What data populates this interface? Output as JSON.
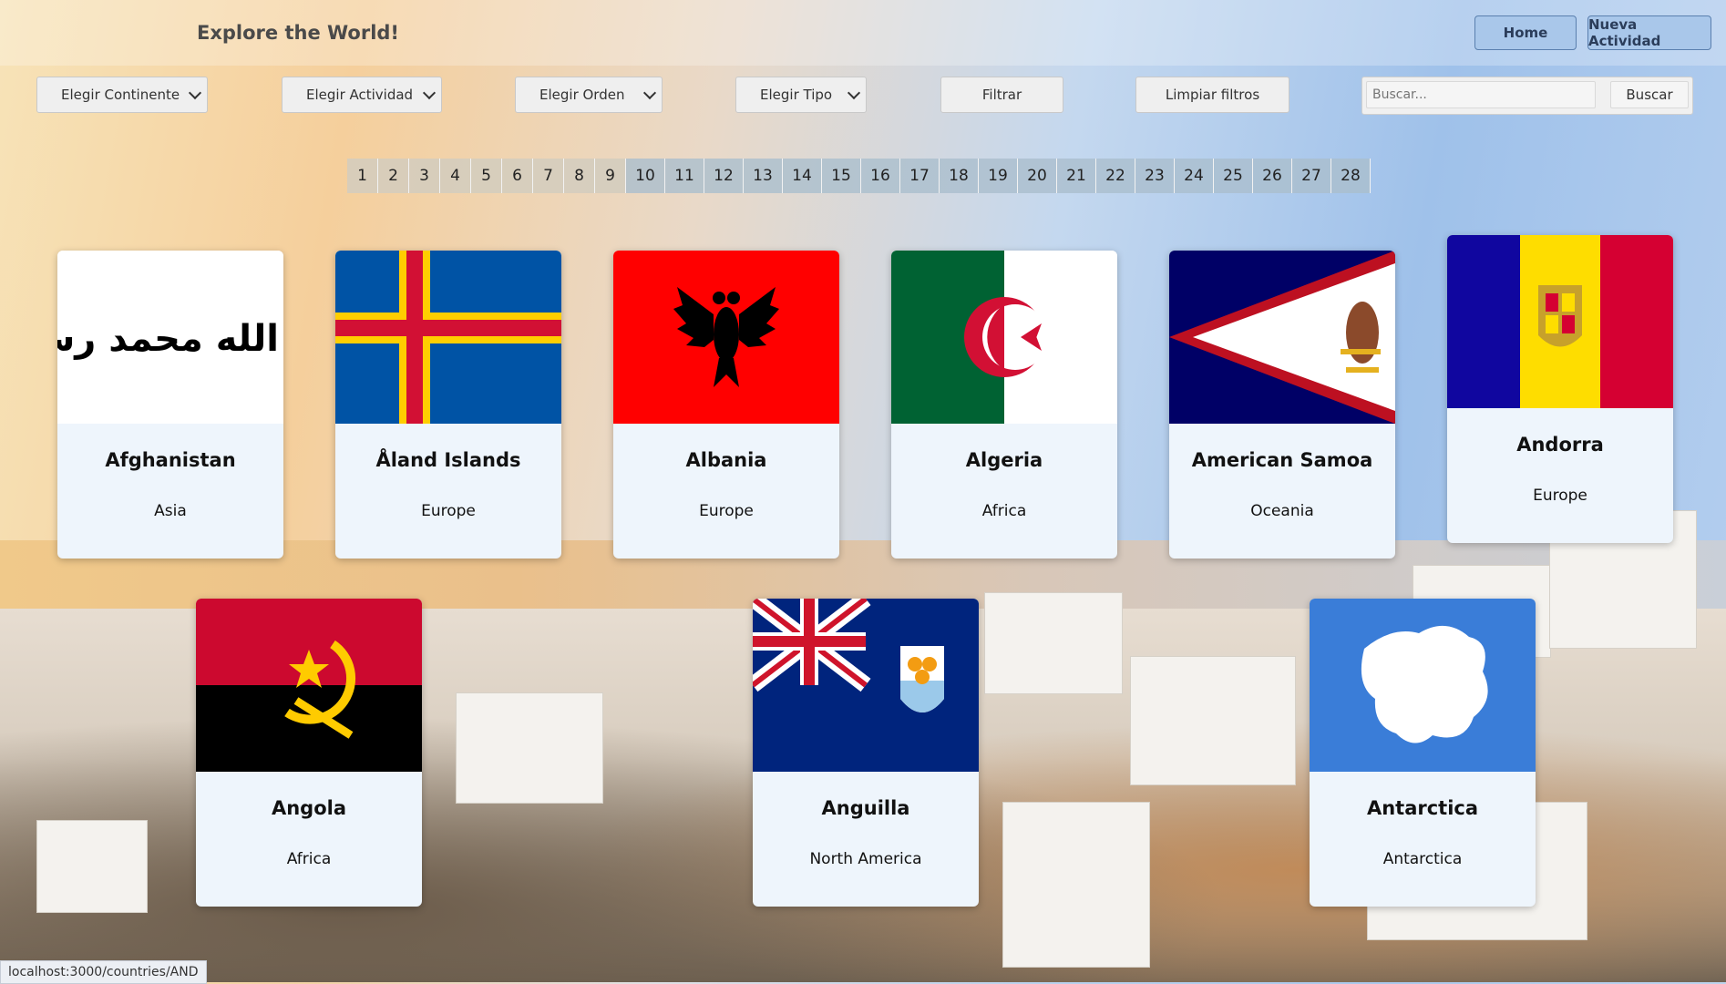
{
  "header": {
    "title": "Explore the World!",
    "home": "Home",
    "new_activity": "Nueva Actividad"
  },
  "filters": {
    "continent": "Elegir Continente",
    "activity": "Elegir Actividad",
    "order": "Elegir Orden",
    "type": "Elegir Tipo",
    "filter_btn": "Filtrar",
    "clear_btn": "Limpiar filtros",
    "search_placeholder": "Buscar...",
    "search_btn": "Buscar"
  },
  "pagination": {
    "pages": [
      "1",
      "2",
      "3",
      "4",
      "5",
      "6",
      "7",
      "8",
      "9",
      "10",
      "11",
      "12",
      "13",
      "14",
      "15",
      "16",
      "17",
      "18",
      "19",
      "20",
      "21",
      "22",
      "23",
      "24",
      "25",
      "26",
      "27",
      "28"
    ],
    "current": "1"
  },
  "countries": [
    {
      "name": "Afghanistan",
      "continent": "Asia"
    },
    {
      "name": "Åland Islands",
      "continent": "Europe"
    },
    {
      "name": "Albania",
      "continent": "Europe"
    },
    {
      "name": "Algeria",
      "continent": "Africa"
    },
    {
      "name": "American Samoa",
      "continent": "Oceania"
    },
    {
      "name": "Andorra",
      "continent": "Europe"
    },
    {
      "name": "Angola",
      "continent": "Africa"
    },
    {
      "name": "Anguilla",
      "continent": "North America"
    },
    {
      "name": "Antarctica",
      "continent": "Antarctica"
    }
  ],
  "flag_shahada_text": "لا اله الا الله محمد رسول الله",
  "status_url": "localhost:3000/countries/AND"
}
